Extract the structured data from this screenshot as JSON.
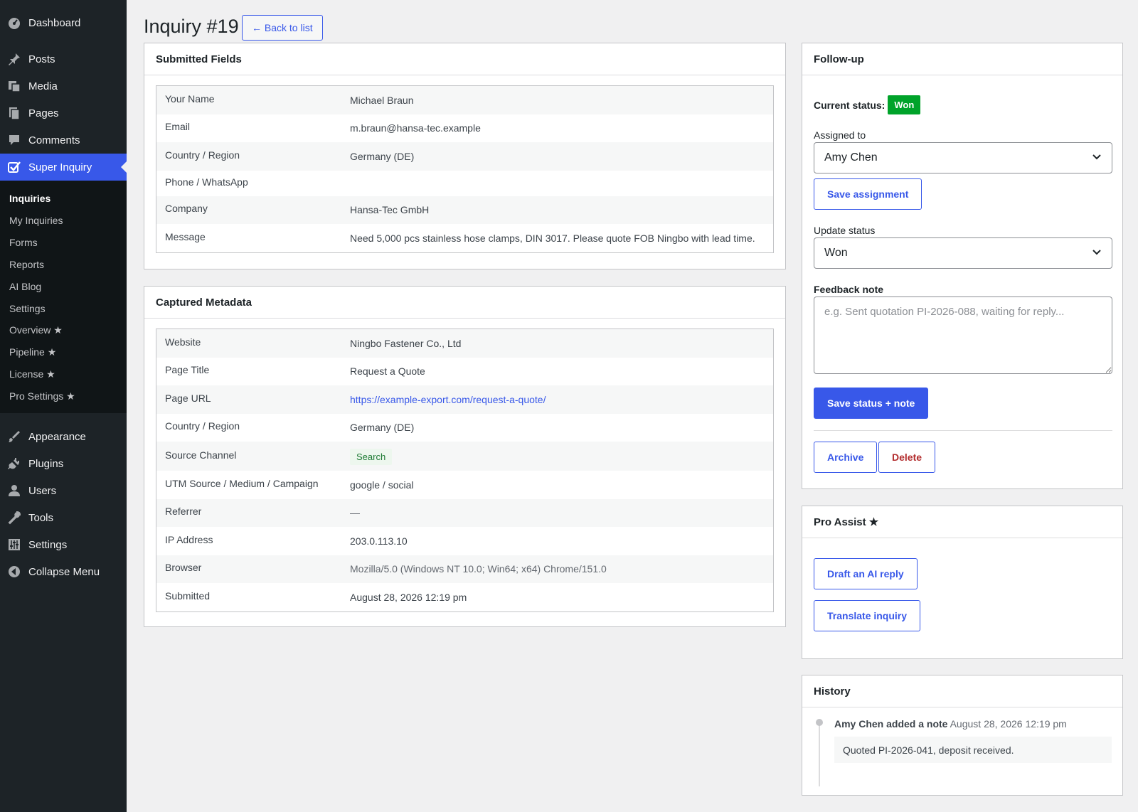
{
  "sidebar": {
    "top": [
      {
        "label": "Dashboard",
        "icon": "dashboard-icon"
      },
      {
        "label": "Posts",
        "icon": "pin-icon"
      },
      {
        "label": "Media",
        "icon": "media-icon"
      },
      {
        "label": "Pages",
        "icon": "pages-icon"
      },
      {
        "label": "Comments",
        "icon": "comments-icon"
      },
      {
        "label": "Super Inquiry",
        "icon": "check-icon"
      }
    ],
    "submenu": [
      "Inquiries",
      "My Inquiries",
      "Forms",
      "Reports",
      "AI Blog",
      "Settings",
      "Overview ★",
      "Pipeline ★",
      "License ★",
      "Pro Settings ★"
    ],
    "bottom": [
      {
        "label": "Appearance",
        "icon": "brush-icon"
      },
      {
        "label": "Plugins",
        "icon": "plugin-icon"
      },
      {
        "label": "Users",
        "icon": "user-icon"
      },
      {
        "label": "Tools",
        "icon": "wrench-icon"
      },
      {
        "label": "Settings",
        "icon": "sliders-icon"
      },
      {
        "label": "Collapse Menu",
        "icon": "collapse-icon"
      }
    ]
  },
  "header": {
    "title": "Inquiry #19",
    "back_label": "← Back to list"
  },
  "submitted": {
    "title": "Submitted Fields",
    "rows": [
      {
        "label": "Your Name",
        "value": "Michael Braun"
      },
      {
        "label": "Email",
        "value": "m.braun@hansa-tec.example"
      },
      {
        "label": "Country / Region",
        "value": "Germany (DE)"
      },
      {
        "label": "Phone / WhatsApp",
        "value": ""
      },
      {
        "label": "Company",
        "value": "Hansa-Tec GmbH"
      },
      {
        "label": "Message",
        "value": "Need 5,000 pcs stainless hose clamps, DIN 3017. Please quote FOB Ningbo with lead time."
      }
    ]
  },
  "metadata": {
    "title": "Captured Metadata",
    "rows": [
      {
        "label": "Website",
        "value": "Ningbo Fastener Co., Ltd"
      },
      {
        "label": "Page Title",
        "value": "Request a Quote"
      },
      {
        "label": "Page URL",
        "value": "https://example-export.com/request-a-quote/"
      },
      {
        "label": "Country / Region",
        "value": "Germany (DE)"
      },
      {
        "label": "Source Channel",
        "value": "Search"
      },
      {
        "label": "UTM Source / Medium / Campaign",
        "value": "google / social"
      },
      {
        "label": "Referrer",
        "value": "—"
      },
      {
        "label": "IP Address",
        "value": "203.0.113.10"
      },
      {
        "label": "Browser",
        "value": "Mozilla/5.0 (Windows NT 10.0; Win64; x64) Chrome/151.0"
      },
      {
        "label": "Submitted",
        "value": "August 28, 2026 12:19 pm"
      }
    ]
  },
  "followup": {
    "title": "Follow-up",
    "current_status_label": "Current status:",
    "current_status": "Won",
    "assigned_label": "Assigned to",
    "assigned_value": "Amy Chen",
    "save_assignment": "Save assignment",
    "update_status_label": "Update status",
    "update_status_value": "Won",
    "feedback_label": "Feedback note",
    "feedback_placeholder": "e.g. Sent quotation PI-2026-088, waiting for reply...",
    "save_status": "Save status + note",
    "archive": "Archive",
    "delete": "Delete"
  },
  "pro_assist": {
    "title": "Pro Assist ★",
    "draft": "Draft an AI reply",
    "translate": "Translate inquiry"
  },
  "history": {
    "title": "History",
    "entries": [
      {
        "author_action": "Amy Chen added a note",
        "time": "August 28, 2026 12:19 pm",
        "note": "Quoted PI-2026-041, deposit received."
      }
    ]
  },
  "colors": {
    "accent": "#3858e9",
    "sidebar": "#1d2327",
    "won": "#00a32a",
    "delete": "#b32d2e"
  }
}
